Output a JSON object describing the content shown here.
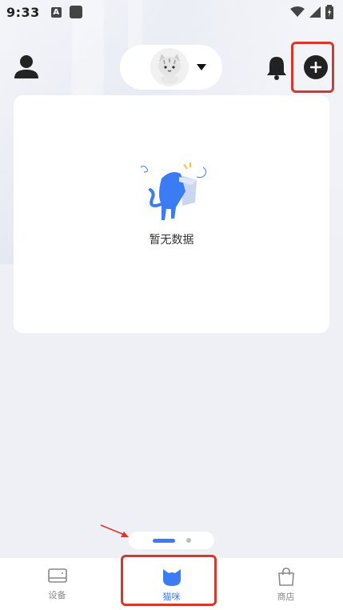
{
  "status_bar": {
    "time": "9:33",
    "indicator_a": "A"
  },
  "header": {
    "user_icon": "person-icon",
    "pet_selector_icon": "cat-avatar-icon",
    "bell_icon": "bell-icon",
    "add_icon": "plus-circle-icon"
  },
  "main": {
    "empty_text": "暂无数据"
  },
  "bottom_nav": {
    "items": [
      {
        "label": "设备",
        "icon": "device-icon"
      },
      {
        "label": "猫咪",
        "icon": "cat-head-icon"
      },
      {
        "label": "商店",
        "icon": "shopping-bag-icon"
      }
    ],
    "active_index": 1
  },
  "colors": {
    "accent": "#3b7cf5",
    "highlight": "#d6382b",
    "background": "#eef0f6"
  }
}
